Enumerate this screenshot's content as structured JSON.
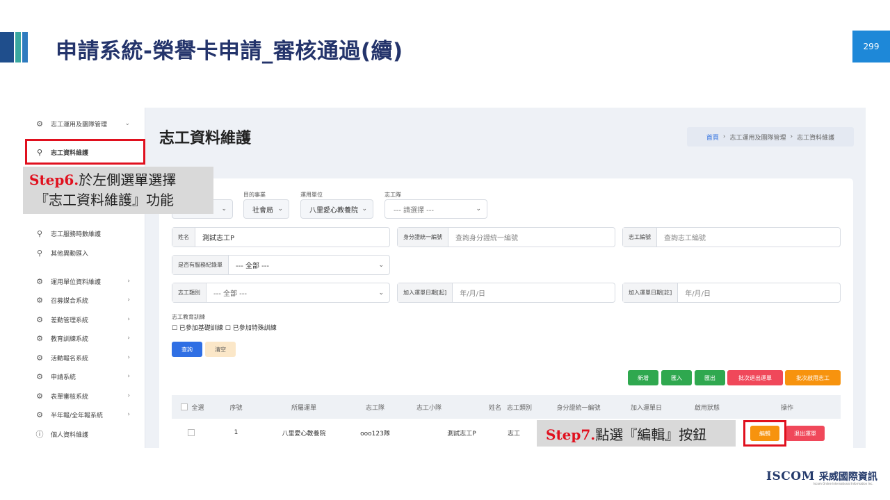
{
  "slide": {
    "title": "申請系統-榮譽卡申請_審核通過(續)",
    "page_number": "299"
  },
  "sidebar": {
    "items": [
      {
        "label": "志工運用及團隊管理",
        "icon": "gear-icon"
      },
      {
        "label": "志工資料維護",
        "icon": "user-icon"
      },
      {
        "label": "志工服務時數維護",
        "icon": "user-icon"
      },
      {
        "label": "其他異動匯入",
        "icon": "user-icon"
      },
      {
        "label": "運用單位資料維護",
        "icon": "gear-icon"
      },
      {
        "label": "召募媒合系統",
        "icon": "gear-icon"
      },
      {
        "label": "差勤管理系統",
        "icon": "gear-icon"
      },
      {
        "label": "教育訓練系統",
        "icon": "gear-icon"
      },
      {
        "label": "活動報名系統",
        "icon": "gear-icon"
      },
      {
        "label": "申請系統",
        "icon": "gear-icon"
      },
      {
        "label": "表單審核系統",
        "icon": "gear-icon"
      },
      {
        "label": "半年報/全年報系統",
        "icon": "gear-icon"
      },
      {
        "label": "個人資料維護",
        "icon": "info-icon"
      }
    ]
  },
  "main": {
    "title": "志工資料維護",
    "breadcrumb": [
      "首頁",
      "志工運用及團隊管理",
      "志工資料維護"
    ]
  },
  "filters": {
    "purpose_label": "目的事業",
    "purpose_value": "社會局",
    "unit_label": "運用單位",
    "unit_value": "八里愛心教養院",
    "team_label": "志工隊",
    "team_placeholder": "--- 請選擇 ---",
    "name_label": "姓名",
    "name_value": "測試志工P",
    "id_label": "身分證統一編號",
    "id_placeholder": "查詢身分證統一編號",
    "card_label": "志工編號",
    "card_placeholder": "查詢志工編號",
    "expired_label": "是否有服務紀錄單",
    "expired_value": "--- 全部 ---",
    "type_label": "志工類別",
    "type_value": "--- 全部 ---",
    "join_start_label": "加入運單日期[起]",
    "join_start_placeholder": "年/月/日",
    "join_end_label": "加入運單日期[訖]",
    "join_end_placeholder": "年/月/日",
    "training_title": "志工教育訓練",
    "training_options": "☐ 已參加基礎訓練 ☐ 已參加特殊訓練",
    "search_btn": "查詢",
    "clear_btn": "清空"
  },
  "actions": {
    "add": "新增",
    "import": "匯入",
    "export": "匯出",
    "batch_export": "批次退出運單",
    "batch_enable": "批次啟用志工"
  },
  "table": {
    "headers": [
      "全選",
      "序號",
      "所屬運單",
      "志工隊",
      "志工小隊",
      "姓名",
      "志工類別",
      "身分證統一編號",
      "加入運單日",
      "啟用狀態",
      "操作"
    ],
    "rows": [
      {
        "seq": "1",
        "unit": "八里愛心教養院",
        "team": "ooo123隊",
        "squad": "",
        "name": "測試志工P",
        "type": "志工",
        "edit_btn": "編輯",
        "exit_btn": "退出運單"
      }
    ]
  },
  "annotations": {
    "step6_label": "Step6.",
    "step6_text": "於左側選單選擇",
    "step6_text2": "『志工資料維護』功能",
    "step7_label": "Step7.",
    "step7_text": "點選『編輯』按鈕",
    "highlight_color": "#e0101e"
  },
  "logo": {
    "main": "ISCOM",
    "cn": "采威國際資訊",
    "sub": "Iscom Online International Information Inc."
  }
}
